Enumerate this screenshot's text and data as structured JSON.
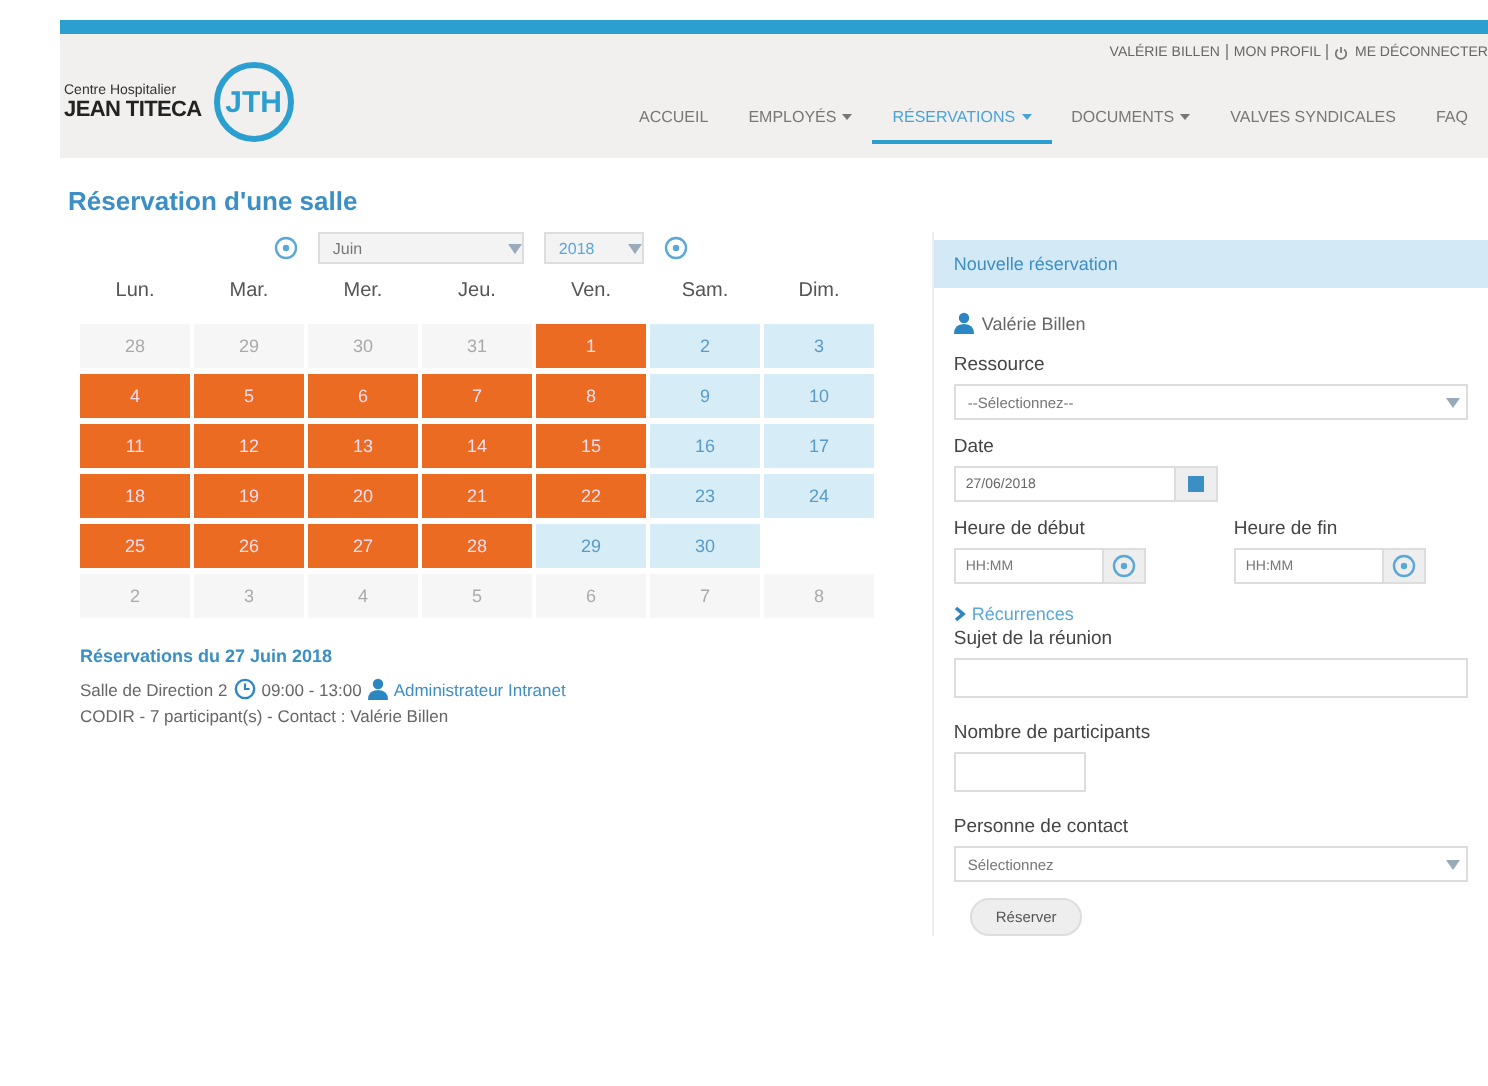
{
  "header": {
    "logo_line1": "Centre Hospitalier",
    "logo_line2": "JEAN TITECA",
    "logo_mark": "JTH",
    "user_links": [
      {
        "label": "VALÉRIE BILLEN",
        "kind": "text"
      },
      {
        "label": "MON PROFIL",
        "kind": "text"
      },
      {
        "label": "ME DÉCONNECTER",
        "kind": "power"
      }
    ],
    "nav": [
      {
        "label": "ACCUEIL",
        "selected": false,
        "dropdown": false
      },
      {
        "label": "EMPLOYÉS",
        "selected": false,
        "dropdown": true
      },
      {
        "label": "RÉSERVATIONS",
        "selected": true,
        "dropdown": true
      },
      {
        "label": "DOCUMENTS",
        "selected": false,
        "dropdown": true
      },
      {
        "label": "VALVES SYNDICALES",
        "selected": false,
        "dropdown": false
      },
      {
        "label": "FAQ",
        "selected": false,
        "dropdown": false
      }
    ]
  },
  "page_title": "Réservation d'une salle",
  "calendar": {
    "month": "Juin",
    "year": "2018",
    "weekdays": [
      "Lun.",
      "Mar.",
      "Mer.",
      "Jeu.",
      "Ven.",
      "Sam.",
      "Dim."
    ],
    "days": [
      {
        "label": "28",
        "kind": "other"
      },
      {
        "label": "29",
        "kind": "other"
      },
      {
        "label": "30",
        "kind": "other"
      },
      {
        "label": "31",
        "kind": "other"
      },
      {
        "label": "1",
        "kind": "booked"
      },
      {
        "label": "2",
        "kind": "free"
      },
      {
        "label": "3",
        "kind": "free"
      },
      {
        "label": "4",
        "kind": "booked"
      },
      {
        "label": "5",
        "kind": "booked"
      },
      {
        "label": "6",
        "kind": "booked"
      },
      {
        "label": "7",
        "kind": "booked"
      },
      {
        "label": "8",
        "kind": "booked"
      },
      {
        "label": "9",
        "kind": "free"
      },
      {
        "label": "10",
        "kind": "free"
      },
      {
        "label": "11",
        "kind": "booked"
      },
      {
        "label": "12",
        "kind": "booked"
      },
      {
        "label": "13",
        "kind": "booked"
      },
      {
        "label": "14",
        "kind": "booked"
      },
      {
        "label": "15",
        "kind": "booked"
      },
      {
        "label": "16",
        "kind": "free"
      },
      {
        "label": "17",
        "kind": "free"
      },
      {
        "label": "18",
        "kind": "booked"
      },
      {
        "label": "19",
        "kind": "booked"
      },
      {
        "label": "20",
        "kind": "booked"
      },
      {
        "label": "21",
        "kind": "booked"
      },
      {
        "label": "22",
        "kind": "booked"
      },
      {
        "label": "23",
        "kind": "free"
      },
      {
        "label": "24",
        "kind": "free"
      },
      {
        "label": "25",
        "kind": "booked"
      },
      {
        "label": "26",
        "kind": "booked"
      },
      {
        "label": "27",
        "kind": "booked"
      },
      {
        "label": "28",
        "kind": "booked"
      },
      {
        "label": "29",
        "kind": "free"
      },
      {
        "label": "30",
        "kind": "free"
      },
      {
        "kind": "blank"
      },
      {
        "label": "2",
        "kind": "other"
      },
      {
        "label": "3",
        "kind": "other"
      },
      {
        "label": "4",
        "kind": "other"
      },
      {
        "label": "5",
        "kind": "other"
      },
      {
        "label": "6",
        "kind": "other"
      },
      {
        "label": "7",
        "kind": "other"
      },
      {
        "label": "8",
        "kind": "other"
      }
    ]
  },
  "reservations": {
    "title": "Réservations du 27 Juin 2018",
    "items": [
      {
        "room": "Salle de Direction 2",
        "time": "09:00 - 13:00",
        "organizer": "Administrateur Intranet",
        "details": "CODIR - 7 participant(s) - Contact : Valérie Billen"
      }
    ]
  },
  "form": {
    "title": "Nouvelle réservation",
    "user": "Valérie Billen",
    "resource_label": "Ressource",
    "resource_value": "--Sélectionnez--",
    "date_label": "Date",
    "date_value": "27/06/2018",
    "start_label": "Heure de début",
    "start_placeholder": "HH:MM",
    "end_label": "Heure de fin",
    "end_placeholder": "HH:MM",
    "recurrence_link": "Récurrences",
    "subject_label": "Sujet de la réunion",
    "participants_label": "Nombre de participants",
    "contact_label": "Personne de contact",
    "contact_value": "Sélectionnez",
    "submit": "Réserver"
  }
}
